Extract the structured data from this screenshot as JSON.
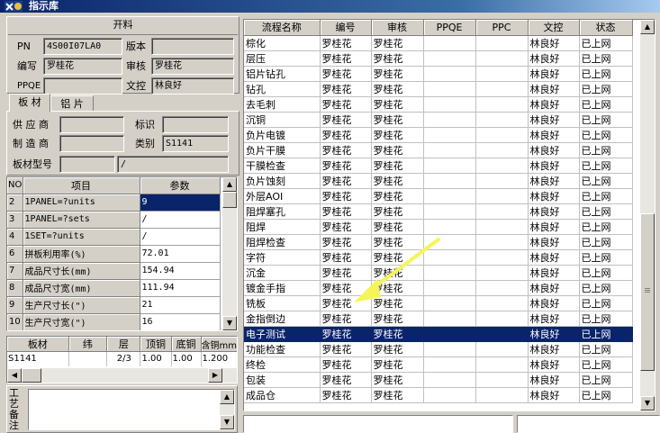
{
  "window": {
    "title": "指示库"
  },
  "open_material": {
    "header": "开料",
    "pn_label": "PN",
    "pn_value": "4S00I07LA0",
    "version_label": "版本",
    "version_value": "",
    "author_label": "编写",
    "author_value": "罗桂花",
    "reviewer_label": "审核",
    "reviewer_value": "罗桂花",
    "ppqe_label": "PPQE",
    "ppqe_value": "",
    "docctrl_label": "文控",
    "docctrl_value": "林良好"
  },
  "tabs": [
    {
      "label": "板 材"
    },
    {
      "label": "铝 片"
    }
  ],
  "board": {
    "supplier_label": "供 应 商",
    "supplier_value": "",
    "mark_label": "标识",
    "mark_value": "",
    "maker_label": "制 造 商",
    "maker_value": "",
    "category_label": "类别",
    "category_value": "S1141",
    "model_label": "板材型号",
    "model_value": "",
    "model_suffix": "/"
  },
  "params": {
    "headers": [
      "NO",
      "项目",
      "参数"
    ],
    "rows": [
      [
        "2",
        "1PANEL=?units",
        "9"
      ],
      [
        "3",
        "1PANEL=?sets",
        "/"
      ],
      [
        "4",
        "1SET=?units",
        "/"
      ],
      [
        "6",
        "拼板利用率(%)",
        "72.01"
      ],
      [
        "7",
        "成品尺寸长(mm)",
        "154.94"
      ],
      [
        "8",
        "成品尺寸宽(mm)",
        "111.94"
      ],
      [
        "9",
        "生产尺寸长(\")",
        "21"
      ],
      [
        "10",
        "生产尺寸宽(\")",
        "16"
      ]
    ]
  },
  "materials": {
    "headers": [
      "板材",
      "纬",
      "层",
      "顶铜",
      "底铜",
      "含铜mm"
    ],
    "rows": [
      [
        "S1141",
        "",
        "2/3",
        "1.00",
        "1.00",
        "1.200"
      ]
    ]
  },
  "notes": {
    "label": "工艺备注",
    "value": ""
  },
  "process": {
    "headers": [
      "流程名称",
      "编号",
      "审核",
      "PPQE",
      "PPC",
      "文控",
      "状态"
    ],
    "selected_index": 20,
    "rows": [
      [
        "棕化",
        "罗桂花",
        "罗桂花",
        "",
        "",
        "林良好",
        "已上网"
      ],
      [
        "层压",
        "罗桂花",
        "罗桂花",
        "",
        "",
        "林良好",
        "已上网"
      ],
      [
        "铝片钻孔",
        "罗桂花",
        "罗桂花",
        "",
        "",
        "林良好",
        "已上网"
      ],
      [
        "钻孔",
        "罗桂花",
        "罗桂花",
        "",
        "",
        "林良好",
        "已上网"
      ],
      [
        "去毛刺",
        "罗桂花",
        "罗桂花",
        "",
        "",
        "林良好",
        "已上网"
      ],
      [
        "沉铜",
        "罗桂花",
        "罗桂花",
        "",
        "",
        "林良好",
        "已上网"
      ],
      [
        "负片电镀",
        "罗桂花",
        "罗桂花",
        "",
        "",
        "林良好",
        "已上网"
      ],
      [
        "负片干膜",
        "罗桂花",
        "罗桂花",
        "",
        "",
        "林良好",
        "已上网"
      ],
      [
        "干膜检查",
        "罗桂花",
        "罗桂花",
        "",
        "",
        "林良好",
        "已上网"
      ],
      [
        "负片蚀刻",
        "罗桂花",
        "罗桂花",
        "",
        "",
        "林良好",
        "已上网"
      ],
      [
        "外层AOI",
        "罗桂花",
        "罗桂花",
        "",
        "",
        "林良好",
        "已上网"
      ],
      [
        "阻焊塞孔",
        "罗桂花",
        "罗桂花",
        "",
        "",
        "林良好",
        "已上网"
      ],
      [
        "阻焊",
        "罗桂花",
        "罗桂花",
        "",
        "",
        "林良好",
        "已上网"
      ],
      [
        "阻焊检查",
        "罗桂花",
        "罗桂花",
        "",
        "",
        "林良好",
        "已上网"
      ],
      [
        "字符",
        "罗桂花",
        "罗桂花",
        "",
        "",
        "林良好",
        "已上网"
      ],
      [
        "沉金",
        "罗桂花",
        "罗桂花",
        "",
        "",
        "林良好",
        "已上网"
      ],
      [
        "镀金手指",
        "罗桂花",
        "罗桂花",
        "",
        "",
        "林良好",
        "已上网"
      ],
      [
        "铣板",
        "罗桂花",
        "罗桂花",
        "",
        "",
        "林良好",
        "已上网"
      ],
      [
        "金指倒边",
        "罗桂花",
        "罗桂花",
        "",
        "",
        "林良好",
        "已上网"
      ],
      [
        "电子测试",
        "罗桂花",
        "罗桂花",
        "",
        "",
        "林良好",
        "已上网"
      ],
      [
        "功能检查",
        "罗桂花",
        "罗桂花",
        "",
        "",
        "林良好",
        "已上网"
      ],
      [
        "终检",
        "罗桂花",
        "罗桂花",
        "",
        "",
        "林良好",
        "已上网"
      ],
      [
        "包装",
        "罗桂花",
        "罗桂花",
        "",
        "",
        "林良好",
        "已上网"
      ],
      [
        "成品仓",
        "罗桂花",
        "罗桂花",
        "",
        "",
        "林良好",
        "已上网"
      ]
    ]
  },
  "colors": {
    "selection": "#0a246a",
    "face": "#d4d0c8",
    "annotation_arrow": "#f5f55a"
  },
  "icons": [
    "app-icon",
    "scroll-up-arrow-icon",
    "scroll-down-arrow-icon",
    "scroll-left-arrow-icon",
    "scroll-right-arrow-icon",
    "annotation-arrow-icon"
  ]
}
